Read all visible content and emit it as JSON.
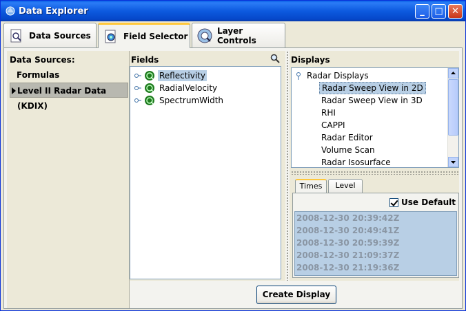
{
  "window": {
    "title": "Data Explorer",
    "minimize": "_",
    "maximize": "□",
    "close": "✕"
  },
  "tabs": [
    {
      "label": "Data Sources"
    },
    {
      "label": "Field Selector"
    },
    {
      "label": "Layer Controls"
    }
  ],
  "data_sources": {
    "label": "Data Sources:",
    "items": [
      "Formulas",
      "Level II Radar Data (KDIX)"
    ]
  },
  "fields": {
    "label": "Fields",
    "items": [
      "Reflectivity",
      "RadialVelocity",
      "SpectrumWidth"
    ]
  },
  "displays": {
    "label": "Displays",
    "root": "Radar Displays",
    "items": [
      "Radar Sweep View in 2D",
      "Radar Sweep View in 3D",
      "RHI",
      "CAPPI",
      "Radar Editor",
      "Volume Scan",
      "Radar Isosurface"
    ]
  },
  "times": {
    "tabs": [
      "Times",
      "Level"
    ],
    "use_default": "Use Default",
    "items": [
      "2008-12-30 20:39:42Z",
      "2008-12-30 20:49:41Z",
      "2008-12-30 20:59:39Z",
      "2008-12-30 21:09:37Z",
      "2008-12-30 21:19:36Z"
    ]
  },
  "create_display": "Create Display",
  "colors": {
    "titlebar": "#0a5fe6",
    "selection": "#b8cfe5",
    "tab_highlight": "#ffc83c"
  }
}
